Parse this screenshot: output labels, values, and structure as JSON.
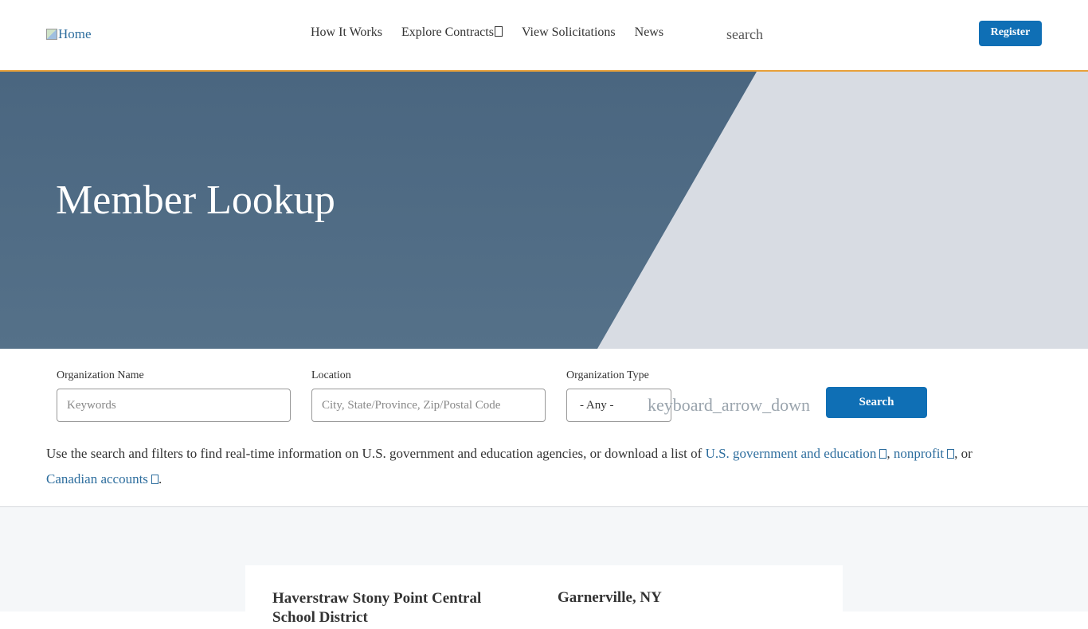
{
  "header": {
    "logo_alt": "Home",
    "nav": [
      {
        "label": "How It Works"
      },
      {
        "label": "Explore Contracts"
      },
      {
        "label": "View Solicitations"
      },
      {
        "label": "News"
      }
    ],
    "search_label": "search",
    "register_label": "Register",
    "accent_color": "#e8a13a"
  },
  "hero": {
    "title": "Member Lookup"
  },
  "form": {
    "org_name_label": "Organization Name",
    "org_name_placeholder": "Keywords",
    "location_label": "Location",
    "location_placeholder": "City, State/Province, Zip/Postal Code",
    "org_type_label": "Organization Type",
    "org_type_value": "- Any -",
    "org_type_icon_text": "keyboard_arrow_down",
    "search_button": "Search"
  },
  "description": {
    "text_before": "Use the search and filters to find real-time information on U.S. government and education agencies, or download a list of ",
    "link_gov": "U.S. government and education",
    "sep1": ", ",
    "link_nonprofit": "nonprofit",
    "sep2": ", or ",
    "link_canadian": "Canadian accounts",
    "end": "."
  },
  "results": [
    {
      "name": "Haverstraw Stony Point Central School District",
      "location": "Garnerville, NY"
    }
  ],
  "colors": {
    "primary_button": "#0f6fb5",
    "hero_dark": "#4f6a82",
    "hero_light": "#d8dce3",
    "link": "#2e6e9e"
  }
}
